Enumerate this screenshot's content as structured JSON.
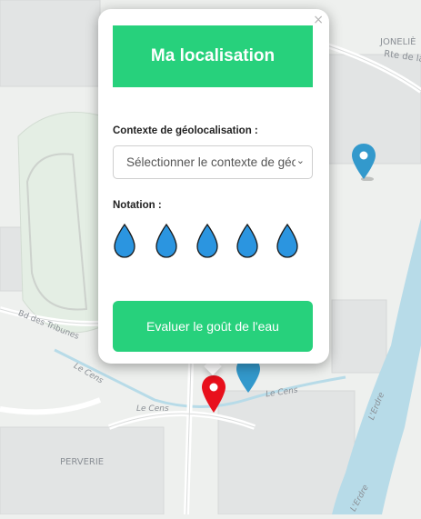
{
  "map": {
    "labels": {
      "jonelie": "JONELIÈ",
      "rte_de_la": "Rte de la",
      "bd_des_tribunes": "Bd des Tribunes",
      "le_cens_1": "Le Cens",
      "le_cens_2": "Le Cens",
      "le_cens_3": "Le Cens",
      "perverie": "PERVERIE",
      "l_erdre_1": "L'Erdre",
      "l_erdre_2": "L'Erdre"
    },
    "markers": [
      {
        "name": "blue-marker-right",
        "color": "#3399cc"
      },
      {
        "name": "blue-marker-bottom",
        "color": "#3399cc"
      },
      {
        "name": "red-marker-selected",
        "color": "#e8101c"
      }
    ]
  },
  "popup": {
    "close_label": "×",
    "title": "Ma localisation",
    "context_label": "Contexte de géolocalisation :",
    "context_select_value": "Sélectionner le contexte de géolocalisation",
    "rating_label": "Notation :",
    "rating_drops": 5,
    "rating_value": 0,
    "drop_color": "#2b95e0",
    "evaluate_button": "Evaluer le goût de l'eau"
  },
  "colors": {
    "accent": "#27d17c",
    "map_bg": "#eef0ee",
    "water": "#b7dbe8"
  }
}
